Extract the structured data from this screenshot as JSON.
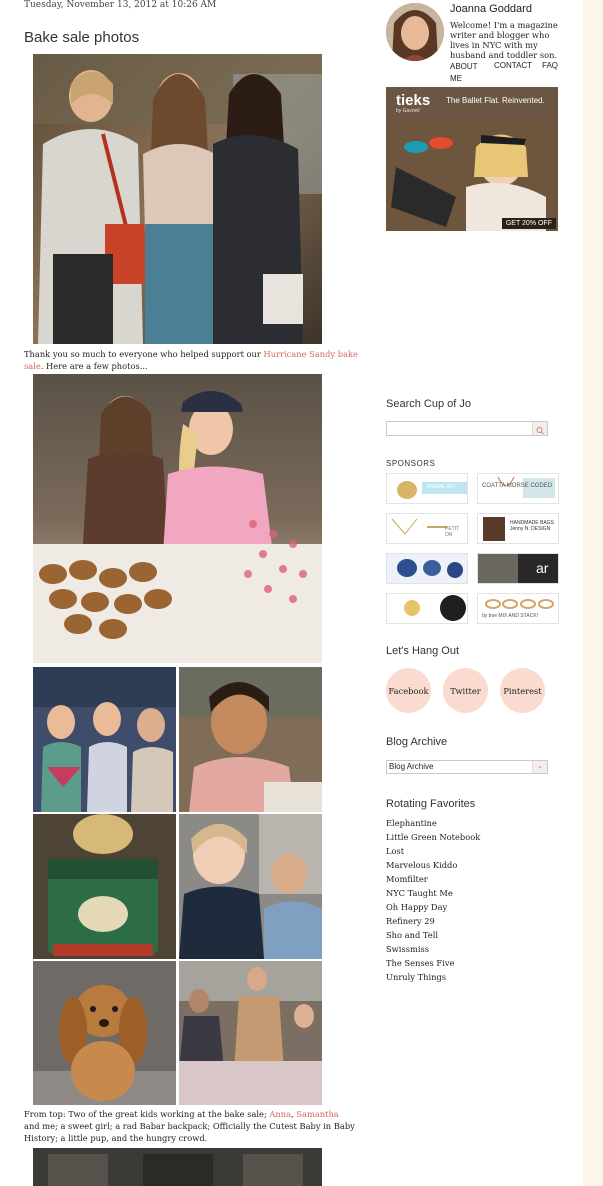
{
  "post": {
    "date": "Tuesday, November 13, 2012 at 10:26 AM",
    "title": "Bake sale photos",
    "intro_before": "Thank you so much to everyone who helped support our ",
    "intro_link": "Hurricane Sandy bake sale",
    "intro_after": ". Here are a few photos...",
    "caption_before": "From top: Two of the great kids working at the bake sale; ",
    "caption_link1": "Anna",
    "caption_comma": ", ",
    "caption_link2": "Samantha",
    "caption_after": " and me; a sweet girl; a rad Babar backpack; Officially the Cutest Baby in Baby History; a little pup, and the hungry crowd."
  },
  "sidebar": {
    "bio_name": "Joanna Goddard",
    "bio_text": "Welcome! I'm a magazine writer and blogger who lives in NYC with my husband and toddler son.",
    "nav": [
      "ABOUT ME",
      "CONTACT",
      "FAQ"
    ],
    "ad": {
      "brand": "tieks",
      "sub": "by Gavrieli",
      "tagline": "The Ballet Flat. Reinvented.",
      "cta": "GET 20% OFF"
    },
    "search_title": "Search Cup of Jo",
    "sponsors_title": "SPONSORS",
    "sponsors": [
      "ANIMAL ART",
      "COATTA MORSE CODED",
      "PETIT OR",
      "HANDMADE BAGS Jenny N. DESIGN",
      "",
      "ar",
      "",
      "by boe  MIX AND STACK!"
    ],
    "hangout_title": "Let's Hang Out",
    "social": [
      "Facebook",
      "Twitter",
      "Pinterest"
    ],
    "archive_title": "Blog Archive",
    "archive_value": "Blog Archive",
    "favorites_title": "Rotating Favorites",
    "favorites": [
      "Elephantine",
      "Little Green Notebook",
      "Lost",
      "Marvelous Kiddo",
      "Momfilter",
      "NYC Taught Me",
      "Oh Happy Day",
      "Refinery 29",
      "Sho and Tell",
      "Swissmiss",
      "The Senses Five",
      "Unruly Things"
    ]
  },
  "colors": {
    "link": "#d36b54",
    "social_circle": "#fadbcf",
    "page_bg": "#ffffff",
    "side_strip": "#faf6ea"
  }
}
